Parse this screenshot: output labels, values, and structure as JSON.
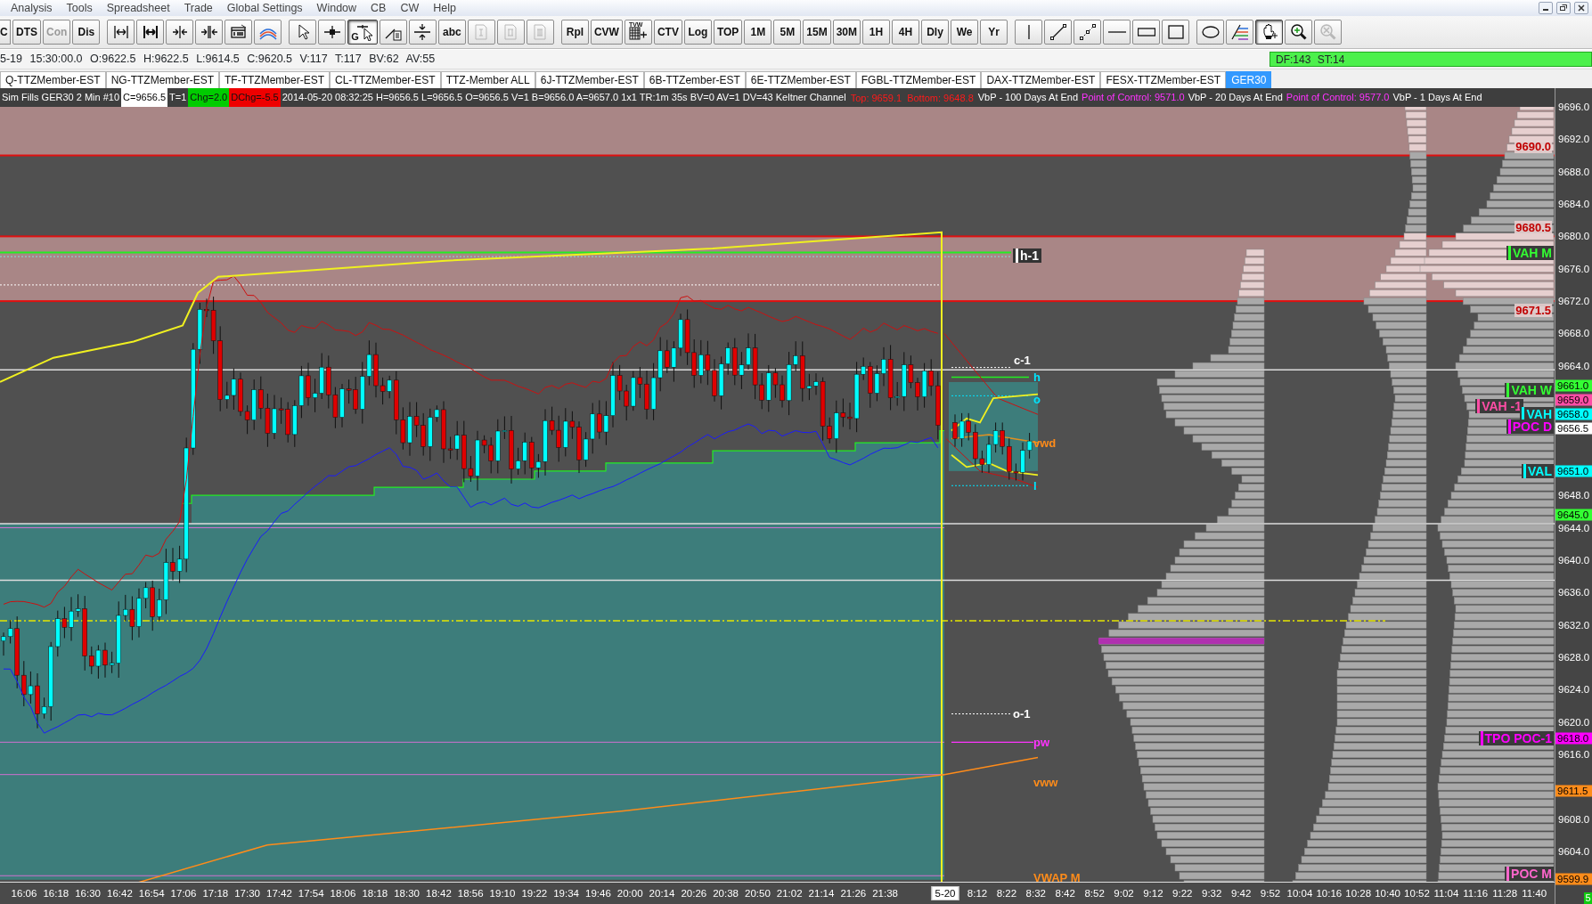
{
  "menu": [
    "Analysis",
    "Tools",
    "Spreadsheet",
    "Trade",
    "Global Settings",
    "Window",
    "CB",
    "CW",
    "Help"
  ],
  "toolbar": [
    {
      "items": [
        {
          "kind": "text",
          "label": "C",
          "selected": false,
          "disabled": false
        },
        {
          "kind": "text",
          "label": "DTS",
          "selected": false,
          "disabled": false
        },
        {
          "kind": "text",
          "label": "Con",
          "selected": false,
          "disabled": true
        },
        {
          "kind": "text",
          "label": "Dis",
          "selected": false,
          "disabled": false
        }
      ]
    },
    {
      "items": [
        {
          "kind": "icon",
          "selected": false,
          "disabled": false
        },
        {
          "kind": "icon",
          "selected": false,
          "disabled": false
        },
        {
          "kind": "icon",
          "selected": false,
          "disabled": false
        },
        {
          "kind": "icon",
          "selected": false,
          "disabled": false
        },
        {
          "kind": "icon",
          "selected": false,
          "disabled": false
        },
        {
          "kind": "icon",
          "selected": false,
          "disabled": false
        }
      ]
    },
    {
      "items": [
        {
          "kind": "icon",
          "selected": false,
          "disabled": false
        },
        {
          "kind": "icon",
          "selected": false,
          "disabled": false
        },
        {
          "kind": "icon",
          "label": "G",
          "selected": true,
          "disabled": false
        },
        {
          "kind": "icon",
          "selected": false,
          "disabled": false
        },
        {
          "kind": "icon",
          "selected": false,
          "disabled": false
        },
        {
          "kind": "text",
          "label": "abc",
          "selected": false,
          "disabled": false
        },
        {
          "kind": "icon",
          "selected": false,
          "disabled": true
        },
        {
          "kind": "icon",
          "selected": false,
          "disabled": true
        },
        {
          "kind": "icon",
          "selected": false,
          "disabled": true
        }
      ]
    },
    {
      "items": [
        {
          "kind": "text",
          "label": "Rpl",
          "selected": false,
          "disabled": false
        },
        {
          "kind": "text",
          "label": "CVW",
          "selected": false,
          "disabled": false
        },
        {
          "kind": "icon",
          "label": "TVW",
          "selected": false,
          "disabled": false
        },
        {
          "kind": "text",
          "label": "CTV",
          "selected": false,
          "disabled": false
        },
        {
          "kind": "text",
          "label": "Log",
          "selected": false,
          "disabled": false
        },
        {
          "kind": "text",
          "label": "TOP",
          "selected": false,
          "disabled": false
        },
        {
          "kind": "text",
          "label": "1M",
          "selected": false,
          "disabled": false
        },
        {
          "kind": "text",
          "label": "5M",
          "selected": false,
          "disabled": false
        },
        {
          "kind": "text",
          "label": "15M",
          "selected": false,
          "disabled": false
        },
        {
          "kind": "text",
          "label": "30M",
          "selected": false,
          "disabled": false
        },
        {
          "kind": "text",
          "label": "1H",
          "selected": false,
          "disabled": false
        },
        {
          "kind": "text",
          "label": "4H",
          "selected": false,
          "disabled": false
        },
        {
          "kind": "text",
          "label": "Dly",
          "selected": false,
          "disabled": false
        },
        {
          "kind": "text",
          "label": "We",
          "selected": false,
          "disabled": false
        },
        {
          "kind": "text",
          "label": "Yr",
          "selected": false,
          "disabled": false
        }
      ]
    },
    {
      "items": [
        {
          "kind": "icon",
          "selected": false,
          "disabled": false
        },
        {
          "kind": "icon",
          "selected": false,
          "disabled": false
        },
        {
          "kind": "icon",
          "selected": false,
          "disabled": false
        },
        {
          "kind": "icon",
          "selected": false,
          "disabled": false
        },
        {
          "kind": "icon",
          "selected": false,
          "disabled": false
        },
        {
          "kind": "icon",
          "selected": false,
          "disabled": false
        }
      ]
    },
    {
      "items": [
        {
          "kind": "icon",
          "selected": false,
          "disabled": false
        },
        {
          "kind": "icon",
          "selected": false,
          "disabled": false
        },
        {
          "kind": "icon",
          "selected": true,
          "disabled": false
        },
        {
          "kind": "icon",
          "selected": false,
          "disabled": false
        },
        {
          "kind": "icon",
          "selected": false,
          "disabled": true
        }
      ]
    }
  ],
  "quote_line": {
    "text": "5-19 15:30:00.0 O:9622.5 H:9622.5 L:9614.5 C:9620.5 V:117 T:117 BV:62 AV:55",
    "status": "DF:143 ST:14"
  },
  "tabs": [
    {
      "label": "Q-TTZMember-EST",
      "selected": false
    },
    {
      "label": "NG-TTZMember-EST",
      "selected": false
    },
    {
      "label": "TF-TTZMember-EST",
      "selected": false
    },
    {
      "label": "CL-TTZMember-EST",
      "selected": false
    },
    {
      "label": "TTZ-Member ALL",
      "selected": false
    },
    {
      "label": "6J-TTZMember-EST",
      "selected": false
    },
    {
      "label": "6B-TTZember-EST",
      "selected": false
    },
    {
      "label": "6E-TTZMember-EST",
      "selected": false
    },
    {
      "label": "FGBL-TTZMember-EST",
      "selected": false
    },
    {
      "label": "DAX-TTZMember-EST",
      "selected": false
    },
    {
      "label": "FESX-TTZMember-EST",
      "selected": false
    },
    {
      "label": "GER30",
      "selected": true
    }
  ],
  "chart_header": [
    {
      "kind": "plain",
      "text": "Sim Fills GER30 2 Min #10"
    },
    {
      "kind": "value",
      "text": "C=9656.5"
    },
    {
      "kind": "plain",
      "text": "T=1"
    },
    {
      "kind": "up",
      "text": "Chg=2.0"
    },
    {
      "kind": "down",
      "text": "DChg=-5.5"
    },
    {
      "kind": "plain",
      "text": "2014-05-20 08:32:25 H=9656.5 L=9656.5 O=9656.5 V=1 B=9656.0 A=9657.0 1x1 TR:1m 35s BV=0 AV=1 DV=43 Keltner Channel"
    },
    {
      "kind": "alert",
      "text": "Top: 9659.1"
    },
    {
      "kind": "alert",
      "text": "Bottom: 9648.8"
    },
    {
      "kind": "plain",
      "text": "VbP - 100 Days At End"
    },
    {
      "kind": "poc",
      "text": "Point of Control: 9571.0"
    },
    {
      "kind": "plain",
      "text": "VbP - 20 Days At End"
    },
    {
      "kind": "poc",
      "text": "Point of Control: 9577.0"
    },
    {
      "kind": "plain",
      "text": "VbP - 1 Days At End"
    }
  ],
  "line_labels": [
    {
      "kind": "boxed",
      "text": "h-1",
      "color": "#ffffff"
    },
    {
      "kind": "plain",
      "text": "c-1",
      "color": "#ffffff"
    },
    {
      "kind": "plain",
      "text": "h",
      "color": "#00e5ff"
    },
    {
      "kind": "plain",
      "text": "o",
      "color": "#00e5ff"
    },
    {
      "kind": "plain",
      "text": "vwd",
      "color": "#ff8c1a"
    },
    {
      "kind": "plain",
      "text": "l",
      "color": "#00e5ff"
    },
    {
      "kind": "plain",
      "text": "o-1",
      "color": "#ffffff"
    },
    {
      "kind": "plain",
      "text": "pw",
      "color": "#ff33ff"
    },
    {
      "kind": "plain",
      "text": "vww",
      "color": "#ff8c1a"
    },
    {
      "kind": "plain",
      "text": "VWAP M",
      "color": "#ff8c1a"
    }
  ],
  "zone_labels": [
    "9690.0",
    "9680.5",
    "9671.5"
  ],
  "level_labels": [
    {
      "text": "VAH M",
      "color": "#33ff33"
    },
    {
      "text": "VAH W",
      "color": "#33ff33"
    },
    {
      "text": "VAH -1",
      "color": "#ff4da6"
    },
    {
      "text": "VAH",
      "color": "#00ffff"
    },
    {
      "text": "POC D",
      "color": "#ff00ff"
    },
    {
      "text": "VAL",
      "color": "#00ffff"
    },
    {
      "text": "TPO POC-1",
      "color": "#ff00ff"
    },
    {
      "text": "POC M",
      "color": "#ff66cc"
    }
  ],
  "price_ticks": [
    "9696.0",
    "9692.0",
    "9688.0",
    "9684.0",
    "9680.0",
    "9676.0",
    "9672.0",
    "9668.0",
    "9664.0",
    "9648.0",
    "9644.0",
    "9640.0",
    "9636.0",
    "9632.0",
    "9628.0",
    "9624.0",
    "9620.0",
    "9616.0",
    "9608.0",
    "9604.0"
  ],
  "price_tags": [
    {
      "text": "9661.0",
      "color": "#33ff33"
    },
    {
      "text": "9659.0",
      "color": "#ff4da6"
    },
    {
      "text": "9658.0",
      "color": "#00ffff"
    },
    {
      "text": "9656.5",
      "color": "#ffffff"
    },
    {
      "text": "9651.0",
      "color": "#00ffff"
    },
    {
      "text": "9645.0",
      "color": "#33ff33"
    },
    {
      "text": "9618.0",
      "color": "#ff00ff"
    },
    {
      "text": "9611.5",
      "color": "#ff8c1a"
    },
    {
      "text": "9599.9",
      "color": "#ff8c1a"
    }
  ],
  "time_ticks": [
    {
      "kind": "time",
      "label": "16:06"
    },
    {
      "kind": "time",
      "label": "16:18"
    },
    {
      "kind": "time",
      "label": "16:30"
    },
    {
      "kind": "time",
      "label": "16:42"
    },
    {
      "kind": "time",
      "label": "16:54"
    },
    {
      "kind": "time",
      "label": "17:06"
    },
    {
      "kind": "time",
      "label": "17:18"
    },
    {
      "kind": "time",
      "label": "17:30"
    },
    {
      "kind": "time",
      "label": "17:42"
    },
    {
      "kind": "time",
      "label": "17:54"
    },
    {
      "kind": "time",
      "label": "18:06"
    },
    {
      "kind": "time",
      "label": "18:18"
    },
    {
      "kind": "time",
      "label": "18:30"
    },
    {
      "kind": "time",
      "label": "18:42"
    },
    {
      "kind": "time",
      "label": "18:56"
    },
    {
      "kind": "time",
      "label": "19:10"
    },
    {
      "kind": "time",
      "label": "19:22"
    },
    {
      "kind": "time",
      "label": "19:34"
    },
    {
      "kind": "time",
      "label": "19:46"
    },
    {
      "kind": "time",
      "label": "20:00"
    },
    {
      "kind": "time",
      "label": "20:14"
    },
    {
      "kind": "time",
      "label": "20:26"
    },
    {
      "kind": "time",
      "label": "20:38"
    },
    {
      "kind": "time",
      "label": "20:50"
    },
    {
      "kind": "time",
      "label": "21:02"
    },
    {
      "kind": "time",
      "label": "21:14"
    },
    {
      "kind": "time",
      "label": "21:26"
    },
    {
      "kind": "time",
      "label": "21:38"
    },
    {
      "kind": "date",
      "label": "5-20"
    },
    {
      "kind": "time",
      "label": "8:12"
    },
    {
      "kind": "time",
      "label": "8:22"
    },
    {
      "kind": "time",
      "label": "8:32"
    },
    {
      "kind": "time",
      "label": "8:42"
    },
    {
      "kind": "time",
      "label": "8:52"
    },
    {
      "kind": "time",
      "label": "9:02"
    },
    {
      "kind": "time",
      "label": "9:12"
    },
    {
      "kind": "time",
      "label": "9:22"
    },
    {
      "kind": "time",
      "label": "9:32"
    },
    {
      "kind": "time",
      "label": "9:42"
    },
    {
      "kind": "time",
      "label": "9:52"
    },
    {
      "kind": "time",
      "label": "10:04"
    },
    {
      "kind": "time",
      "label": "10:16"
    },
    {
      "kind": "time",
      "label": "10:28"
    },
    {
      "kind": "time",
      "label": "10:40"
    },
    {
      "kind": "time",
      "label": "10:52"
    },
    {
      "kind": "time",
      "label": "11:04"
    },
    {
      "kind": "time",
      "label": "11:16"
    },
    {
      "kind": "time",
      "label": "11:28"
    },
    {
      "kind": "time",
      "label": "11:40"
    }
  ],
  "corner_badge": "5"
}
